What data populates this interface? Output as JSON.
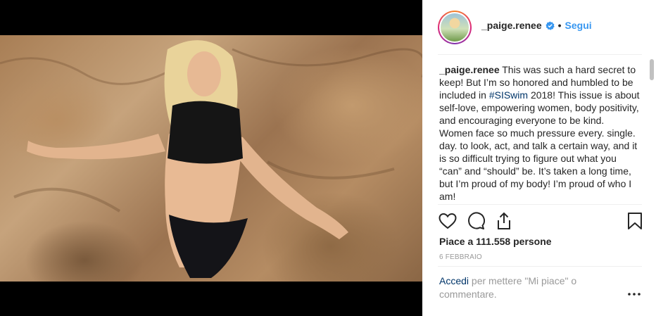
{
  "post": {
    "username": "_paige.renee",
    "follow_label": "Segui",
    "separator": "•",
    "caption": {
      "username": "_paige.renee",
      "text_before": " This was such a hard secret to keep! But I’m so honored and humbled to be included in ",
      "hashtag": "#SISwim",
      "text_after": " 2018! This issue is about self-love, empowering women, body positivity, and encouraging everyone to be kind. Women face so much pressure every. single. day. to look, act, and talk a certain way, and it is so difficult trying to figure out what you “can” and “should” be. It’s taken a long time, but I’m proud of my body! I’m proud of who I am!"
    },
    "likes_text": "Piace a 111.558 persone",
    "date_text": "6 FEBBRAIO",
    "login": {
      "link_label": "Accedi",
      "rest_text": " per mettere \"Mi piace\" o commentare."
    },
    "more_label": "•••"
  },
  "icons": [
    "user-tag-icon",
    "verified-icon",
    "heart-icon",
    "comment-icon",
    "share-icon",
    "bookmark-icon",
    "more-options-icon"
  ],
  "colors": {
    "link_blue": "#3897f0",
    "hashtag_blue": "#003569",
    "text": "#262626",
    "muted": "#999999"
  }
}
